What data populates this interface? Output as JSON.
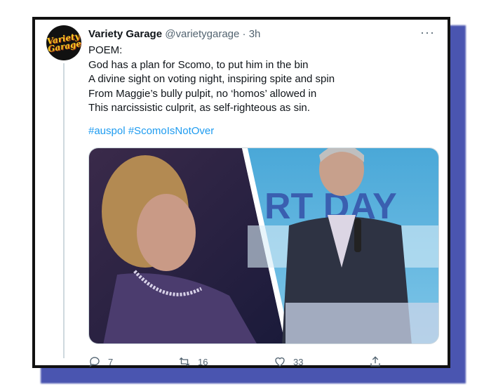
{
  "tweet": {
    "display_name": "Variety Garage",
    "handle": "@varietygarage",
    "separator": "·",
    "time": "3h",
    "avatar_text_line1": "Variety",
    "avatar_text_line2": "Garage",
    "more_label": "···",
    "lines": [
      "POEM:",
      "God has a plan for Scomo, to put him in the bin",
      "A divine sight on voting night, inspiring spite and spin",
      "From Maggie’s bully pulpit, no ‘homos’ allowed in",
      "This narcissistic culprit, as self-righteous as sin."
    ],
    "hashtags": [
      "#auspol",
      "#ScomoIsNotOver"
    ],
    "media": {
      "backdrop_text": "RT  DAY"
    },
    "actions": {
      "reply_count": "7",
      "retweet_count": "16",
      "like_count": "33"
    }
  },
  "colors": {
    "link": "#1d9bf0",
    "secondary_text": "#536471",
    "frame_shadow": "#4a55b0"
  },
  "icons": [
    "more-icon",
    "reply-icon",
    "retweet-icon",
    "like-icon",
    "share-icon"
  ]
}
